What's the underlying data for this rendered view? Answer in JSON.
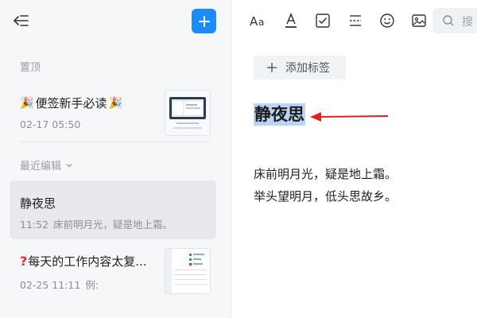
{
  "sidebar": {
    "pinned_label": "置顶",
    "recent_label": "最近编辑",
    "notes": [
      {
        "title": "便签新手必读",
        "date": "02-17 05:50",
        "preview": ""
      },
      {
        "title": "静夜思",
        "date": "11:52",
        "preview": "床前明月光，疑是地上霜。"
      },
      {
        "title": "每天的工作内容太复...",
        "date": "02-25 11:11",
        "preview": "例:"
      }
    ]
  },
  "toolbar": {
    "icons": [
      "font-size-icon",
      "text-color-icon",
      "checkbox-icon",
      "divider-icon",
      "emoji-icon",
      "image-icon",
      "search-icon"
    ],
    "search_placeholder": "搜"
  },
  "editor": {
    "add_tag_label": "添加标签",
    "title": "静夜思",
    "lines": [
      "床前明月光，疑是地上霜。",
      "举头望明月，低头思故乡。"
    ]
  },
  "colors": {
    "accent": "#1a8cff",
    "highlight": "#b9d4f5",
    "arrow": "#e02020"
  }
}
